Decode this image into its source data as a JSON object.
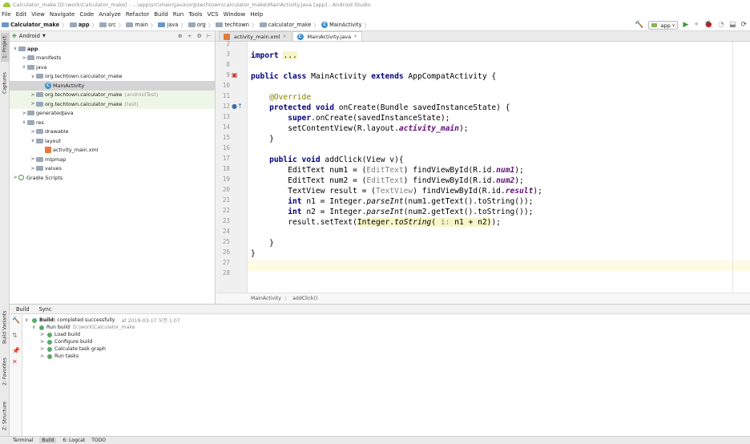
{
  "window": {
    "title": "Calculator_make [D:\\work\\Calculator_make] - ...\\app\\src\\main\\java\\org\\techtown\\calculator_make\\MainActivity.java [app] - Android Studio"
  },
  "menu": [
    "File",
    "Edit",
    "View",
    "Navigate",
    "Code",
    "Analyze",
    "Refactor",
    "Build",
    "Run",
    "Tools",
    "VCS",
    "Window",
    "Help"
  ],
  "breadcrumb": [
    "Calculator_make",
    "app",
    "src",
    "main",
    "java",
    "org",
    "techtown",
    "calculator_make",
    "MainActivity"
  ],
  "toolbar": {
    "run_config": "app"
  },
  "side_tabs": {
    "project": "1: Project",
    "captures": "Captures",
    "build_variants": "Build Variants",
    "favorites": "2: Favorites",
    "structure": "Z: Structure"
  },
  "project": {
    "view_label": "Android",
    "tree": [
      {
        "label": "app",
        "indent": 0,
        "arrow": "∨",
        "icon": "folder",
        "bold": true
      },
      {
        "label": "manifests",
        "indent": 1,
        "arrow": ">",
        "icon": "folder"
      },
      {
        "label": "java",
        "indent": 1,
        "arrow": "∨",
        "icon": "folder"
      },
      {
        "label": "org.techtown.calculator_make",
        "indent": 2,
        "arrow": "∨",
        "icon": "folder"
      },
      {
        "label": "MainActivity",
        "indent": 3,
        "arrow": "",
        "icon": "class",
        "selected": true
      },
      {
        "label": "org.techtown.calculator_make",
        "suffix": "(androidTest)",
        "indent": 2,
        "arrow": ">",
        "icon": "folder",
        "green": true
      },
      {
        "label": "org.techtown.calculator_make",
        "suffix": "(test)",
        "indent": 2,
        "arrow": ">",
        "icon": "folder",
        "green": true
      },
      {
        "label": "generatedJava",
        "indent": 1,
        "arrow": ">",
        "icon": "folder"
      },
      {
        "label": "res",
        "indent": 1,
        "arrow": "∨",
        "icon": "folder"
      },
      {
        "label": "drawable",
        "indent": 2,
        "arrow": ">",
        "icon": "folder"
      },
      {
        "label": "layout",
        "indent": 2,
        "arrow": "∨",
        "icon": "folder"
      },
      {
        "label": "activity_main.xml",
        "indent": 3,
        "arrow": "",
        "icon": "xml"
      },
      {
        "label": "mipmap",
        "indent": 2,
        "arrow": ">",
        "icon": "folder"
      },
      {
        "label": "values",
        "indent": 2,
        "arrow": ">",
        "icon": "folder"
      },
      {
        "label": "Gradle Scripts",
        "indent": 0,
        "arrow": ">",
        "icon": "gradle"
      }
    ]
  },
  "editor": {
    "tabs": [
      {
        "label": "activity_main.xml",
        "active": false
      },
      {
        "label": "MainActivity.java",
        "active": true
      }
    ],
    "line_numbers": [
      "2",
      "3",
      "8",
      "9",
      "10",
      "11",
      "12",
      "13",
      "14",
      "15",
      "16",
      "17",
      "18",
      "19",
      "20",
      "21",
      "22",
      "23",
      "24",
      "25",
      "26",
      "27",
      "28"
    ],
    "breadcrumb": [
      "MainActivity",
      "addClick()"
    ]
  },
  "build": {
    "tabs": [
      "Build",
      "Sync"
    ],
    "status_label": "Build:",
    "status_text": "completed successfully",
    "status_time": "at 2019-03-17 오전 1:07",
    "run_build": "Run build",
    "run_build_path": "D:\\work\\Calculator_make",
    "tasks": [
      "Load build",
      "Configure build",
      "Calculate task graph",
      "Run tasks"
    ]
  },
  "statusbar": [
    "Terminal",
    "Build",
    "6: Logcat",
    "TODO"
  ]
}
